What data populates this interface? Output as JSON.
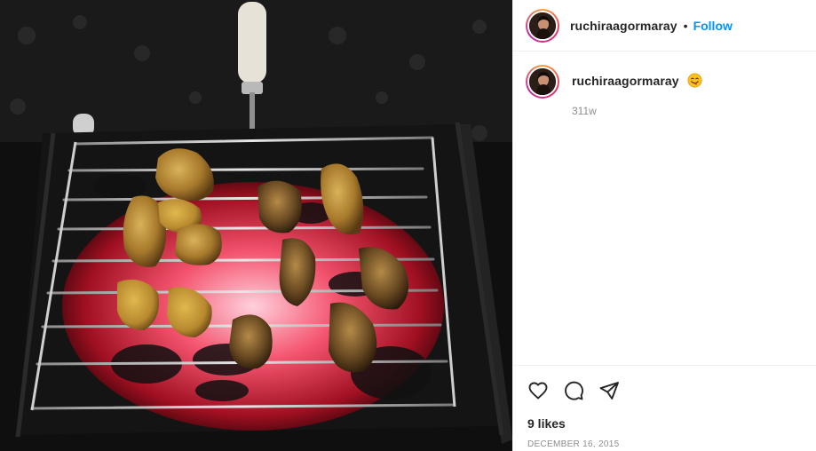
{
  "post": {
    "photo_alt": "",
    "header": {
      "username": "ruchiraagormaray",
      "separator": "•",
      "follow_label": "Follow"
    },
    "caption": {
      "username": "ruchiraagormaray",
      "emoji_icon": "yum-face-emoji",
      "age": "311w"
    },
    "actions": {
      "like_icon": "heart-icon",
      "comment_icon": "comment-icon",
      "share_icon": "send-icon"
    },
    "likes": "9 likes",
    "date": "DECEMBER 16, 2015"
  },
  "colors": {
    "follow": "#0095f6",
    "text": "#262626",
    "muted": "#8e8e8e",
    "divider": "#efefef"
  }
}
